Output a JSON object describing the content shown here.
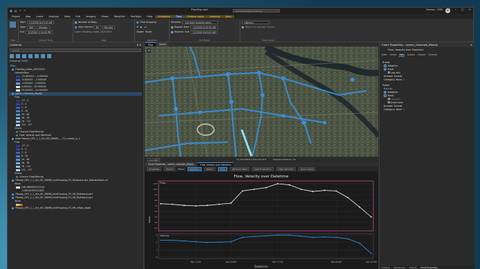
{
  "window": {
    "title": "Flooding.aprx",
    "search_placeholder": "Command Search (Alt+Q)",
    "user": "Benson - ESRI",
    "user_initials": "BE"
  },
  "menu": [
    "Project",
    "Map",
    "Insert",
    "Analysis",
    "View",
    "Edit",
    "Imagery",
    "Share",
    "ToolsGrid",
    "PortTools",
    "Help"
  ],
  "context_tabs": [
    "Animation",
    "Time",
    "Feature Layer",
    "Labeling",
    "Data"
  ],
  "ribbon": {
    "start_label": "Start",
    "start_value": "1/1/2000 8:07:00 AM",
    "span_label": "Span",
    "span_value": "360",
    "span_unit": "Minutes",
    "end_label": "End",
    "end_value": "1/1/2000 1:10:00 PM",
    "current_time_label": "Current Time",
    "number_of_steps": "Number of Steps",
    "step_interval": "Step Interval",
    "step_value": "60",
    "step_unit": "Minutes",
    "layer_label": "Layer: flooding_model_20221024",
    "step_group": "Step",
    "time_snapping": "Time Snapping",
    "playback_group": "Playback",
    "slower": "Slower",
    "faster": "Faster",
    "direction": "Direction",
    "repeat": "Repeat",
    "reverse": "Reverse",
    "full_extent_group": "Full Extent",
    "dir_value": "<All time enabled data>",
    "fe_start": "1/1/2000 8:00:00 AM",
    "fe_end": "1/1/2000 8:00:00 AM",
    "view_group": "View Group",
    "never": "<Never>",
    "adjust_dst": "Adjust For Daylight Saving"
  },
  "contents": {
    "title": "Contents",
    "search_placeholder": "Search",
    "drawing_order": "Drawing Order",
    "items": [
      {
        "label": "Map",
        "type": "hdr"
      },
      {
        "label": "Flooding_nodes_20221024",
        "type": "layer"
      },
      {
        "label": "LateralInflow",
        "type": "sub"
      },
      {
        "label": "-22.800001 - -5.000000",
        "type": "legend",
        "color": "#2a3a8a"
      },
      {
        "label": "-5.000000 - -2.500000",
        "type": "legend",
        "color": "#3a62b0"
      },
      {
        "label": "-2.500000 - 0.000000",
        "type": "legend",
        "color": "#6fa0d0"
      },
      {
        "label": "0.000001 - 25.000000",
        "type": "legend",
        "color": "#d9e6f2"
      },
      {
        "label": "25.000001 - 50.000000",
        "type": "legend",
        "color": "#f0f0f0"
      },
      {
        "label": "swmm_channels_tfloody",
        "type": "sel"
      },
      {
        "label": "Flow",
        "type": "sub"
      },
      {
        "label": "-27 - 0",
        "type": "legend",
        "color": "#2a3a8a"
      },
      {
        "label": "0 - 2",
        "type": "legend",
        "color": "#3048a0"
      },
      {
        "label": "2 - 8",
        "type": "legend",
        "color": "#3a62b0"
      },
      {
        "label": "8 - 20",
        "type": "legend",
        "color": "#4a7cc8"
      },
      {
        "label": "20 - 46",
        "type": "legend",
        "color": "#5a94d8"
      },
      {
        "label": "46 - 78",
        "type": "legend",
        "color": "#74aae0"
      },
      {
        "label": "78 - 112",
        "type": "legend",
        "color": "#90c0ea"
      },
      {
        "label": "112 - 127",
        "type": "legend",
        "color": "#b0d4f2"
      },
      {
        "label": "Charts",
        "type": "sub"
      },
      {
        "label": "Channel Flow/Velocity",
        "type": "chart"
      },
      {
        "label": "Flow, Velocity over Datetime",
        "type": "chart"
      },
      {
        "label": "outer Peachy_GPC_1_1_Grn_RE_SWMM_..._TO_current_in_1",
        "type": "layer"
      },
      {
        "label": "Flow",
        "type": "sub"
      },
      {
        "label": "-27 - 0",
        "type": "legend",
        "color": "#2a3a8a"
      },
      {
        "label": "0 - 2",
        "type": "legend",
        "color": "#3048a0"
      },
      {
        "label": "2 - 8",
        "type": "legend",
        "color": "#3a62b0"
      },
      {
        "label": "8 - 20",
        "type": "legend",
        "color": "#4a7cc8"
      },
      {
        "label": "20 - 46",
        "type": "legend",
        "color": "#5a94d8"
      },
      {
        "label": "46 - 78",
        "type": "legend",
        "color": "#74aae0"
      },
      {
        "label": "78 - 112",
        "type": "legend",
        "color": "#90c0ea"
      },
      {
        "label": "112 - 127",
        "type": "legend",
        "color": "#b0d4f2"
      },
      {
        "label": "Charts",
        "type": "sub"
      },
      {
        "label": "Channel Flow/Velocity",
        "type": "chart"
      },
      {
        "label": "Tfloody_GPC_1_1_Grn_RE_SWMM_InletFlooding_TO_Multiband.ops_flowrateStack.crf",
        "type": "layer"
      },
      {
        "label": "Value",
        "type": "sub"
      },
      {
        "label": "248.5669830322244",
        "type": "legend",
        "color": "#f2f2f2"
      },
      {
        "label": "-1.60016763210483",
        "type": "legend",
        "color": "#222"
      },
      {
        "label": "Tfloody_GPC_1_1_Grn_RE_SWMM_InletFlooding_TO_HR_Multiband.qcrf",
        "type": "layer"
      },
      {
        "label": "Tfloody_GPC_1_1_Grn_RE_SWMM_InletFlooding_TO_HR_Multiband.qcrf",
        "type": "layer"
      },
      {
        "label": "Value",
        "type": "sub"
      },
      {
        "label": "",
        "type": "ramp",
        "color": "#e8a23a"
      },
      {
        "label": "Tfloody_GPC_1_1_Grn_RE_SWMM_InletFlooding_TO_HR_mflow_depth",
        "type": "layer"
      }
    ]
  },
  "map": {
    "tabs": [
      "Map",
      "Scene"
    ],
    "scale": "1:11,527",
    "coords": "71,419,008 E 2,050,314 N ft",
    "selected": "Selected Features: 16"
  },
  "chart": {
    "tabs": [
      "Chart Properties - swmm_channels_tfloody",
      "Flow, Velocity over Datetime"
    ],
    "toolbar": [
      "Properties",
      "Export",
      "Filters:",
      "Selection",
      "Extent",
      "Time",
      "Attribute Table",
      "Switch Selection",
      "Clear Selection",
      "Zoom Chart"
    ],
    "title": "Flow, Velocity over Datetime",
    "xlabel": "Datetime",
    "ylabel": "Value",
    "panel1_label": "Flow",
    "panel2_label": "Velocity",
    "xticks": [
      "Sat 11:00",
      "Sat 14:00",
      "Sat 17:00",
      "Sat 20:00",
      "Sat 23:00"
    ],
    "y1ticks": [
      "110",
      "100",
      "90",
      "80",
      "70",
      "60",
      "50",
      "40",
      "30"
    ],
    "y2ticks": [
      "3",
      "2",
      "1",
      "0"
    ]
  },
  "chart_data": {
    "type": "line",
    "title": "Flow, Velocity over Datetime",
    "xlabel": "Datetime",
    "ylabel": "Value",
    "x": [
      "Sat 08:00",
      "Sat 09:00",
      "Sat 10:00",
      "Sat 11:00",
      "Sat 12:00",
      "Sat 13:00",
      "Sat 14:00",
      "Sat 14:30",
      "Sat 15:00",
      "Sat 16:00",
      "Sat 17:00",
      "Sat 17:30",
      "Sat 18:00",
      "Sat 19:00",
      "Sat 19:30",
      "Sat 20:00",
      "Sat 21:00",
      "Sat 22:00",
      "Sat 23:00"
    ],
    "series": [
      {
        "name": "Flow",
        "ylim": [
          25,
          115
        ],
        "values": [
          74,
          73,
          71,
          70,
          71,
          73,
          75,
          97,
          100,
          103,
          110,
          108,
          100,
          96,
          98,
          97,
          85,
          68,
          50
        ]
      },
      {
        "name": "Velocity",
        "ylim": [
          -0.2,
          3.2
        ],
        "values": [
          2.3,
          2.3,
          2.2,
          2.1,
          2.0,
          2.05,
          2.1,
          2.7,
          2.8,
          2.9,
          3.0,
          3.0,
          2.85,
          2.7,
          2.75,
          2.7,
          2.5,
          1.9,
          0.5
        ]
      }
    ],
    "colors": {
      "Flow": "#ffffff",
      "Velocity": "#2f8fe6",
      "panel1_border": "#c0508a"
    }
  },
  "properties": {
    "title": "Chart Properties - swmm_channels_tfloody",
    "subtitle": "Flow, Velocity over Datetime",
    "tabs": [
      "Data",
      "Series",
      "Axes",
      "Guides",
      "Format",
      "General"
    ],
    "active_tab": "Axes",
    "x_axis": "X-axis",
    "adaptive": "Adaptive",
    "fixed": "Fixed",
    "log_axis": "Log axis",
    "number_format": "Number Format",
    "category_none": "Category: None",
    "y_axis": "Y-axis",
    "bounds": "Bounds",
    "invert": "Invert axis",
    "bottom_tabs": [
      "Catalog",
      "Symbology",
      "Export",
      "Chart Properties"
    ]
  }
}
